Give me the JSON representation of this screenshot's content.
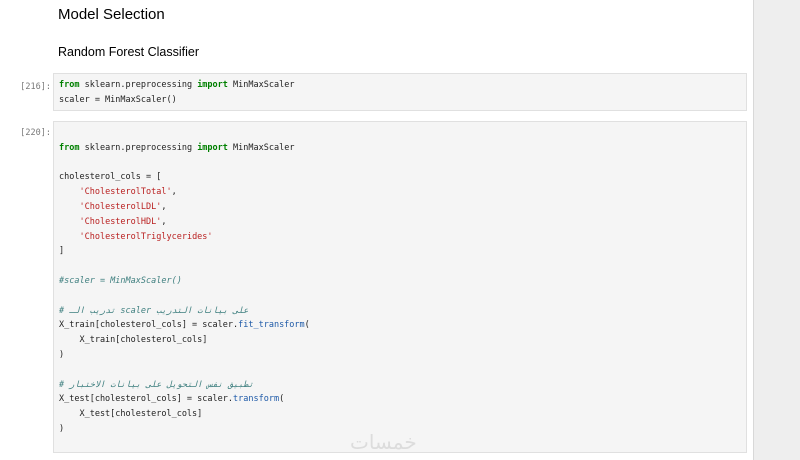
{
  "notebook": {
    "heading": "Model Selection",
    "subheading": "Random Forest Classifier"
  },
  "cells": [
    {
      "prompt": "[216]:",
      "lines": [
        "from sklearn.preprocessing import MinMaxScaler",
        "scaler = MinMaxScaler()"
      ]
    },
    {
      "prompt": "[220]:",
      "lines": [
        "",
        "from sklearn.preprocessing import MinMaxScaler",
        "",
        "cholesterol_cols = [",
        "    'CholesterolTotal',",
        "    'CholesterolLDL',",
        "    'CholesterolHDL',",
        "    'CholesterolTriglycerides'",
        "]",
        "",
        "#scaler = MinMaxScaler()",
        "",
        "# تدريب الـ scaler على بيانات التدريب",
        "X_train[cholesterol_cols] = scaler.fit_transform(",
        "    X_train[cholesterol_cols]",
        ")",
        "",
        "# تطبيق نفس التحويل على بيانات الاختبار",
        "X_test[cholesterol_cols] = scaler.transform(",
        "    X_test[cholesterol_cols]",
        ")"
      ]
    }
  ],
  "watermark": "خمسات",
  "colors": {
    "keyword": "#008000",
    "string": "#ba2121",
    "comment": "#408080",
    "function": "#1e5aa8",
    "cell_background": "#f5f5f5"
  }
}
